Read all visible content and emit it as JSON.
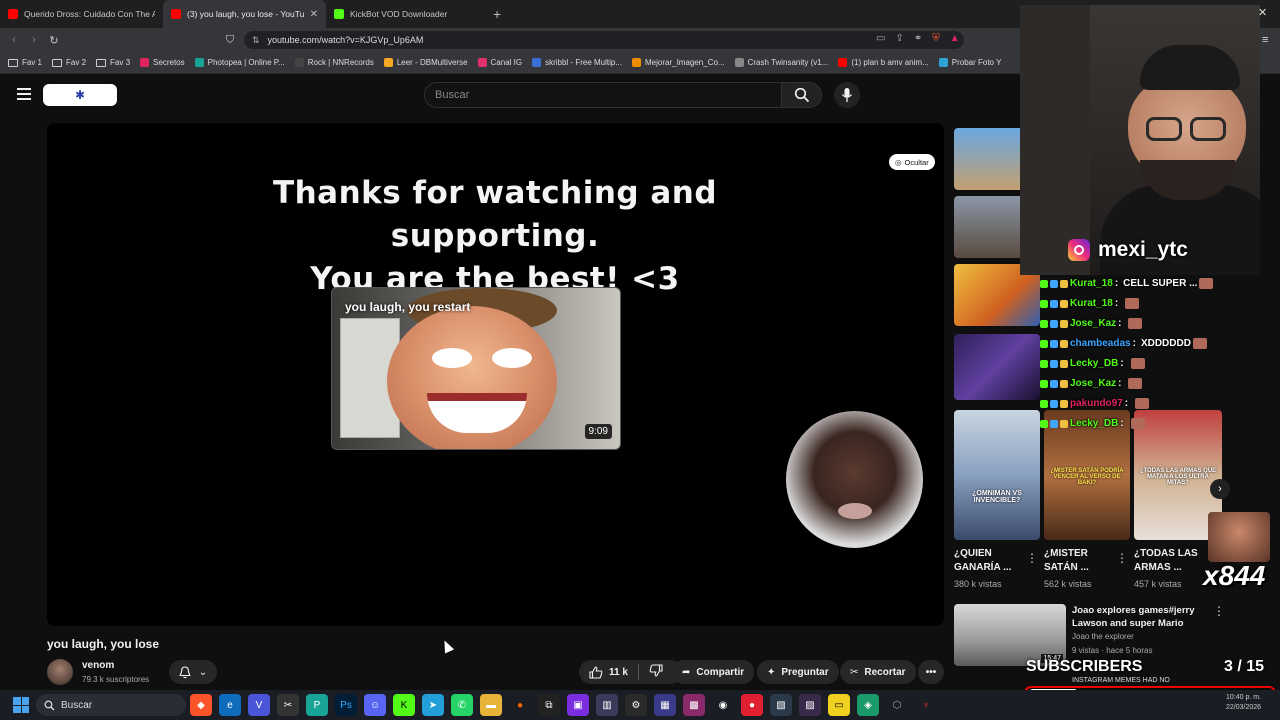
{
  "browser": {
    "tabs": [
      {
        "title": "Querido Dross: Cuidado Con The An",
        "color": "#ff0000"
      },
      {
        "title": "(3) you laugh, you lose - YouTub",
        "color": "#ff0000",
        "active": true
      },
      {
        "title": "KickBot VOD Downloader",
        "color": "#53fc18"
      }
    ],
    "url": "youtube.com/watch?v=KJGVp_Up6AM",
    "bookmarks": [
      {
        "label": "Fav 1",
        "type": "folder"
      },
      {
        "label": "Fav 2",
        "type": "folder"
      },
      {
        "label": "Fav 3",
        "type": "folder"
      },
      {
        "label": "Secretos",
        "color": "#e0245e"
      },
      {
        "label": "Photopea | Online P...",
        "color": "#18a497"
      },
      {
        "label": "Rock | NNRecords",
        "color": "#444"
      },
      {
        "label": "Leer - DBMultiverse",
        "color": "#f5a623"
      },
      {
        "label": "Canal IG",
        "color": "#e1306c"
      },
      {
        "label": "skribbl - Free Multip...",
        "color": "#3a6fd8"
      },
      {
        "label": "Mejorar_Imagen_Co...",
        "color": "#f08c00"
      },
      {
        "label": "Crash Twinsanity (v1...",
        "color": "#888"
      },
      {
        "label": "(1) plan b amv anim...",
        "color": "#ff0000"
      },
      {
        "label": "Probar Foto Y",
        "color": "#2fa3d8"
      }
    ]
  },
  "youtube": {
    "search_placeholder": "Buscar",
    "player": {
      "hide_label": "Ocultar",
      "end_line1": "Thanks for watching and supporting.",
      "end_line2": "You are the best! <3",
      "endcard_title": "you laugh, you restart",
      "endcard_duration": "9:09"
    },
    "video_title": "you laugh, you lose",
    "channel_name": "venom",
    "channel_subs": "79.3 k suscriptores",
    "actions": {
      "likes": "11 k",
      "share": "Compartir",
      "ask": "Preguntar",
      "clip": "Recortar"
    },
    "shorts": [
      {
        "title": "¿QUIEN GANARÍA ...",
        "views": "380 k vistas"
      },
      {
        "title": "¿MISTER SATÁN ...",
        "views": "562 k vistas"
      },
      {
        "title": "¿TODAS LAS ARMAS ...",
        "views": "457 k vistas"
      }
    ],
    "thumb_labels": {
      "omniman": "¿OMNIMAN VS INVENCIBLE?",
      "satan": "¿MISTER SATÁN PODRÍA VENCER AL VERSO DE BAKI?",
      "armas": "¿TODAS LAS ARMAS QUE MATAN A LOS ULTRA MITAS?"
    },
    "rec": {
      "title": "Joao explores games#jerry Lawson and super Mario",
      "channel": "Joao the explorer",
      "meta": "9 vistas · hace 5 horas",
      "duration": "15:47"
    }
  },
  "overlay": {
    "ig_handle": "mexi_ytc",
    "chat": [
      {
        "user": "Kurat_18",
        "color": "#53fc18",
        "msg": "CELL SUPER ..."
      },
      {
        "user": "Kurat_18",
        "color": "#53fc18",
        "msg": ""
      },
      {
        "user": "Jose_Kaz",
        "color": "#53fc18",
        "msg": ""
      },
      {
        "user": "chambeadas",
        "color": "#3ea6ff",
        "msg": "XDDDDDD"
      },
      {
        "user": "Lecky_DB",
        "color": "#53fc18",
        "msg": ""
      },
      {
        "user": "Jose_Kaz",
        "color": "#53fc18",
        "msg": ""
      },
      {
        "user": "pakundo97",
        "color": "#e0245e",
        "msg": ""
      },
      {
        "user": "Lecky_DB",
        "color": "#53fc18",
        "msg": ""
      }
    ],
    "subs_label": "SUBSCRIBERS",
    "subs_count": "3 / 15",
    "subs_progress": 0.2,
    "ticker": "INSTAGRAM MEMES HAD NO",
    "x_count": "x844"
  },
  "taskbar": {
    "search": "Buscar",
    "time": "10:40 p. m.",
    "date": "22/03/2026"
  }
}
